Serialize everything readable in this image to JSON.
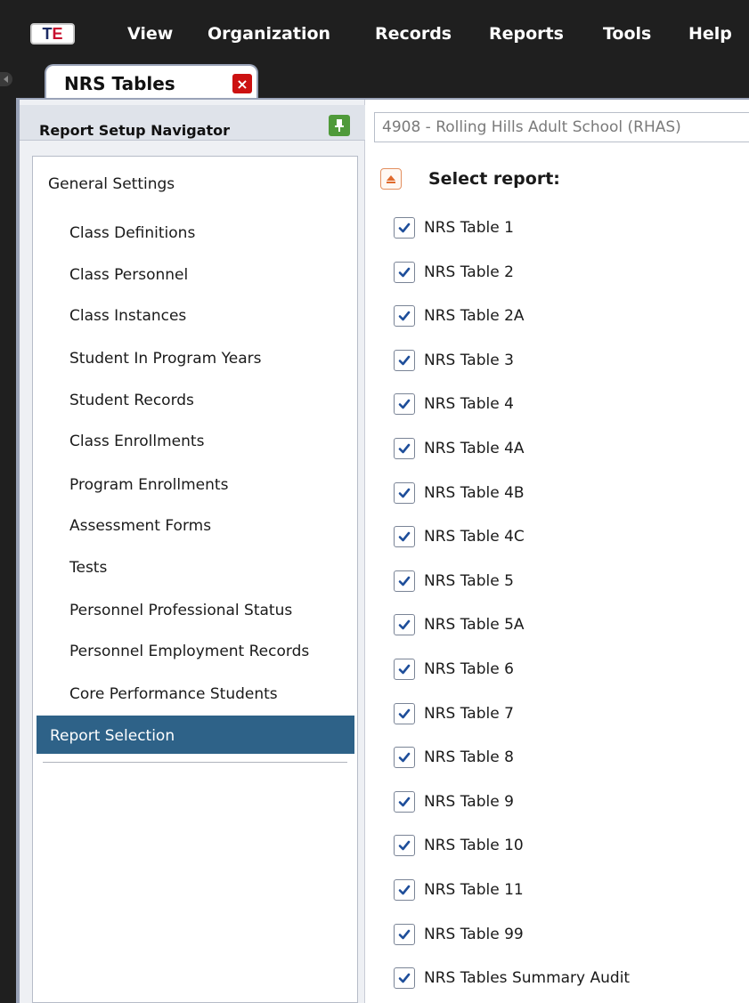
{
  "app": {
    "logo_text_a": "T",
    "logo_text_b": "E"
  },
  "menu": {
    "items": [
      "View",
      "Organization",
      "Records",
      "Reports",
      "Tools",
      "Help"
    ]
  },
  "tabs": [
    {
      "label": "NRS Tables",
      "close_label": "×"
    }
  ],
  "navigator": {
    "title": "Report Setup Navigator",
    "items": [
      {
        "label": "General Settings"
      },
      {
        "label": "Class Definitions"
      },
      {
        "label": "Class Personnel"
      },
      {
        "label": "Class Instances"
      },
      {
        "label": "Student In Program Years"
      },
      {
        "label": "Student Records"
      },
      {
        "label": "Class Enrollments"
      },
      {
        "label": "Program Enrollments"
      },
      {
        "label": "Assessment Forms"
      },
      {
        "label": "Tests"
      },
      {
        "label": "Personnel Professional Status"
      },
      {
        "label": "Personnel Employment Records"
      },
      {
        "label": "Core Performance Students"
      },
      {
        "label": "Report Selection",
        "selected": true
      }
    ]
  },
  "organization": {
    "value": "4908 - Rolling Hills Adult School (RHAS)"
  },
  "report_selection": {
    "title": "Select report:",
    "reports": [
      {
        "label": "NRS Table 1",
        "checked": true
      },
      {
        "label": "NRS Table 2",
        "checked": true
      },
      {
        "label": "NRS Table 2A",
        "checked": true
      },
      {
        "label": "NRS Table 3",
        "checked": true
      },
      {
        "label": "NRS Table 4",
        "checked": true
      },
      {
        "label": "NRS Table 4A",
        "checked": true
      },
      {
        "label": "NRS Table 4B",
        "checked": true
      },
      {
        "label": "NRS Table 4C",
        "checked": true
      },
      {
        "label": "NRS Table 5",
        "checked": true
      },
      {
        "label": "NRS Table 5A",
        "checked": true
      },
      {
        "label": "NRS Table 6",
        "checked": true
      },
      {
        "label": "NRS Table 7",
        "checked": true
      },
      {
        "label": "NRS Table 8",
        "checked": true
      },
      {
        "label": "NRS Table 9",
        "checked": true
      },
      {
        "label": "NRS Table 10",
        "checked": true
      },
      {
        "label": "NRS Table 11",
        "checked": true
      },
      {
        "label": "NRS Table 99",
        "checked": true
      },
      {
        "label": "NRS Tables Summary Audit",
        "checked": true
      }
    ]
  },
  "colors": {
    "menubar_bg": "#1f1f1f",
    "selected_item_bg": "#2e6288",
    "pin_green": "#4f9a3a",
    "close_red": "#cc1111",
    "check_blue": "#1e4e9a"
  }
}
